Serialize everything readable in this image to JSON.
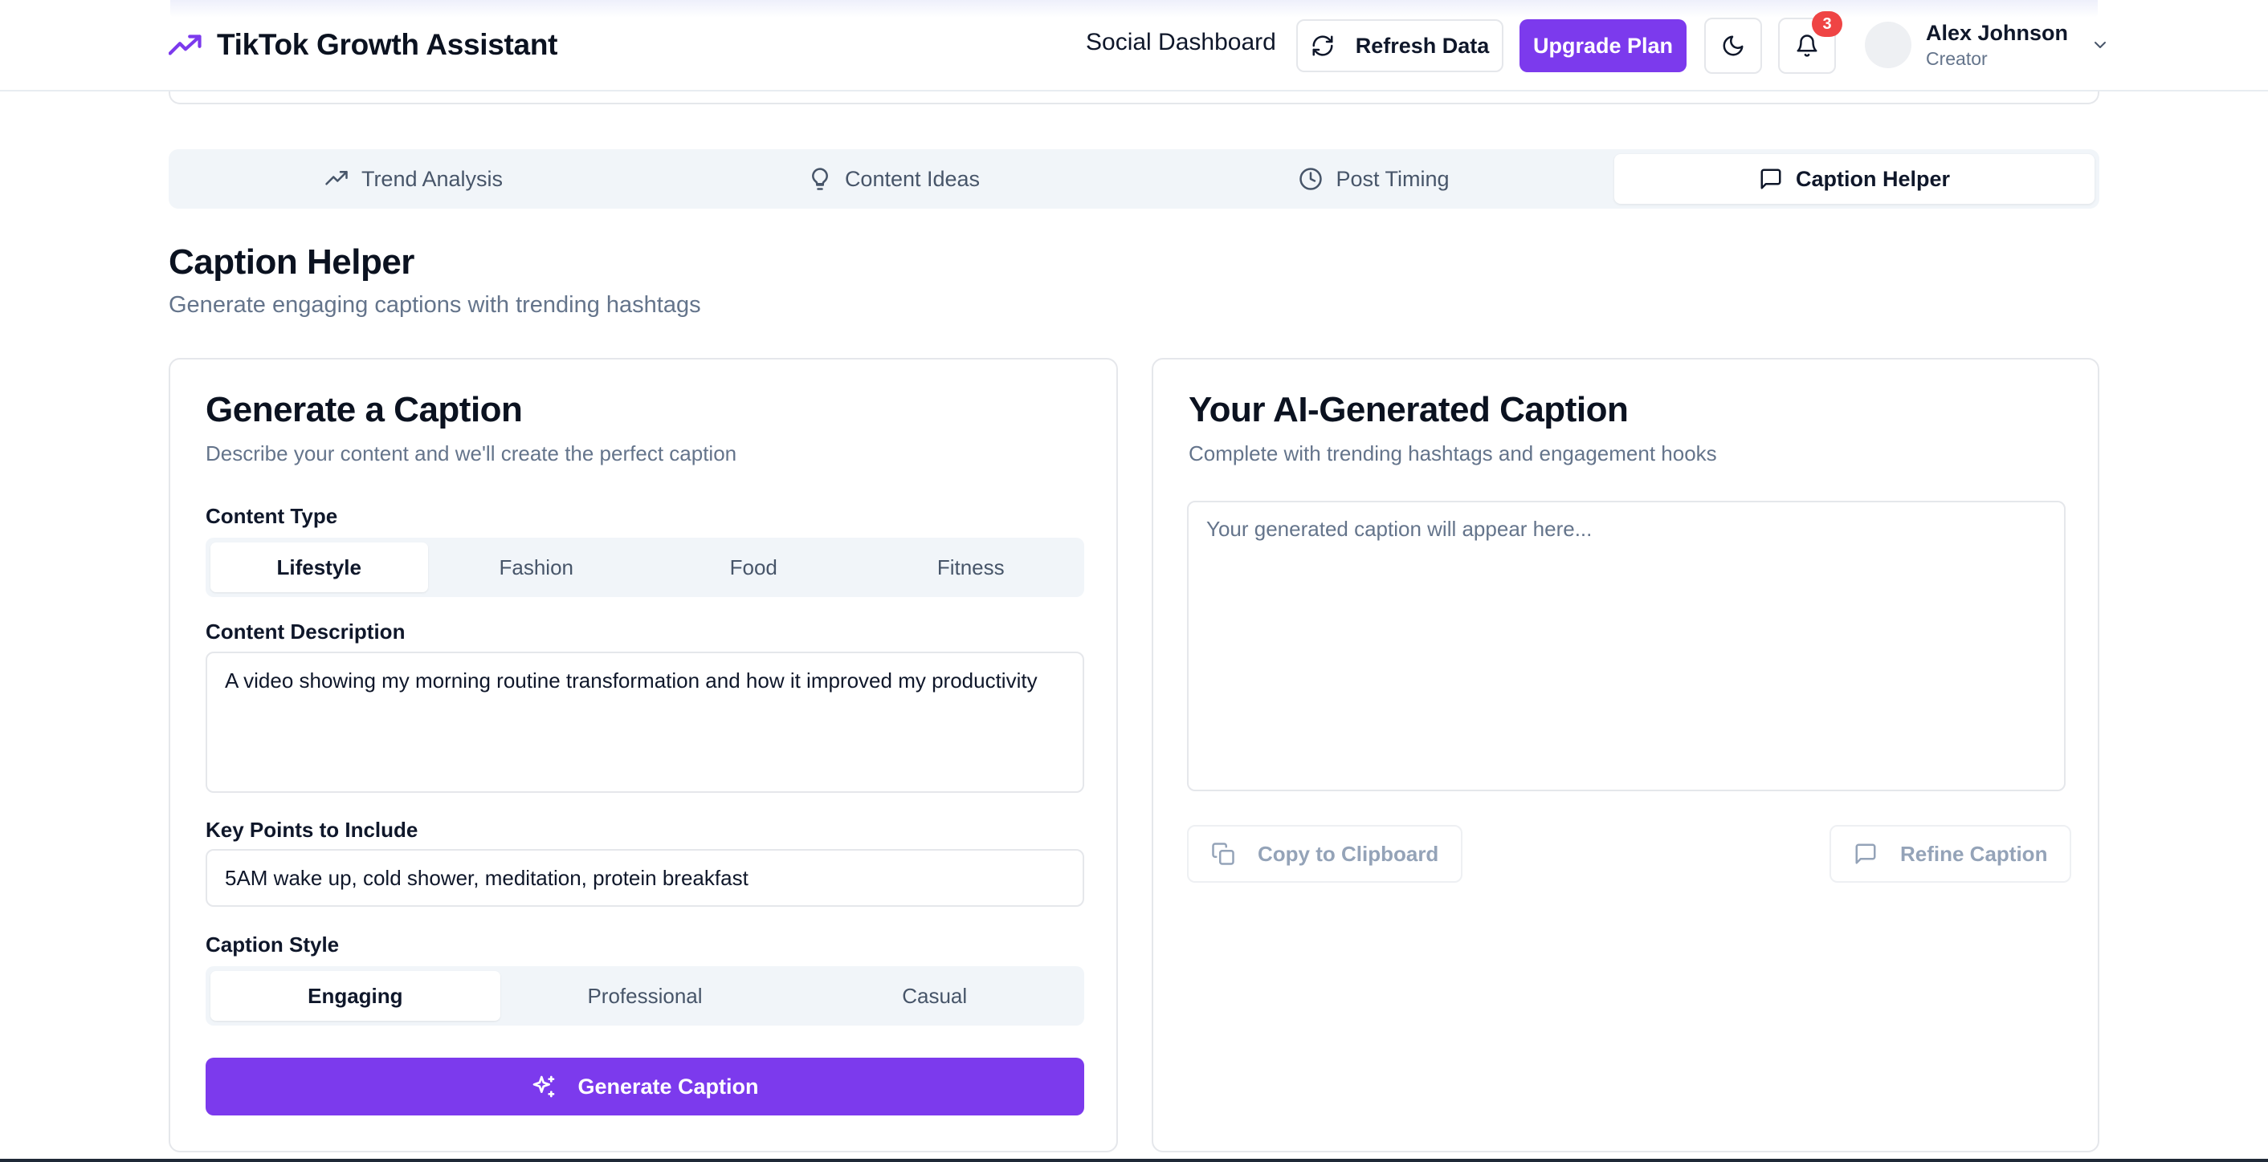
{
  "header": {
    "brand_title": "TikTok Growth Assistant",
    "nav_link": "Social Dashboard",
    "refresh_label": "Refresh Data",
    "upgrade_label": "Upgrade Plan",
    "notification_count": "3",
    "user_name": "Alex Johnson",
    "user_role": "Creator"
  },
  "tabs": [
    {
      "label": "Trend Analysis",
      "icon": "trending-up-icon"
    },
    {
      "label": "Content Ideas",
      "icon": "lightbulb-icon"
    },
    {
      "label": "Post Timing",
      "icon": "clock-icon"
    },
    {
      "label": "Caption Helper",
      "icon": "message-square-icon",
      "active": true
    }
  ],
  "page": {
    "title": "Caption Helper",
    "subtitle": "Generate engaging captions with trending hashtags"
  },
  "generator": {
    "title": "Generate a Caption",
    "subtitle": "Describe your content and we'll create the perfect caption",
    "content_type_label": "Content Type",
    "content_types": [
      "Lifestyle",
      "Fashion",
      "Food",
      "Fitness"
    ],
    "content_type_selected": "Lifestyle",
    "description_label": "Content Description",
    "description_value": "A video showing my morning routine transformation and how it improved my productivity",
    "key_points_label": "Key Points to Include",
    "key_points_value": "5AM wake up, cold shower, meditation, protein breakfast",
    "style_label": "Caption Style",
    "styles": [
      "Engaging",
      "Professional",
      "Casual"
    ],
    "style_selected": "Engaging",
    "generate_label": "Generate Caption"
  },
  "result": {
    "title": "Your AI-Generated Caption",
    "subtitle": "Complete with trending hashtags and engagement hooks",
    "placeholder": "Your generated caption will appear here...",
    "copy_label": "Copy to Clipboard",
    "refine_label": "Refine Caption"
  },
  "colors": {
    "accent": "#7c3aed",
    "badge": "#ef4444",
    "muted_text": "#64748b",
    "border": "#e5e7eb",
    "segment_bg": "#f1f5f9"
  }
}
